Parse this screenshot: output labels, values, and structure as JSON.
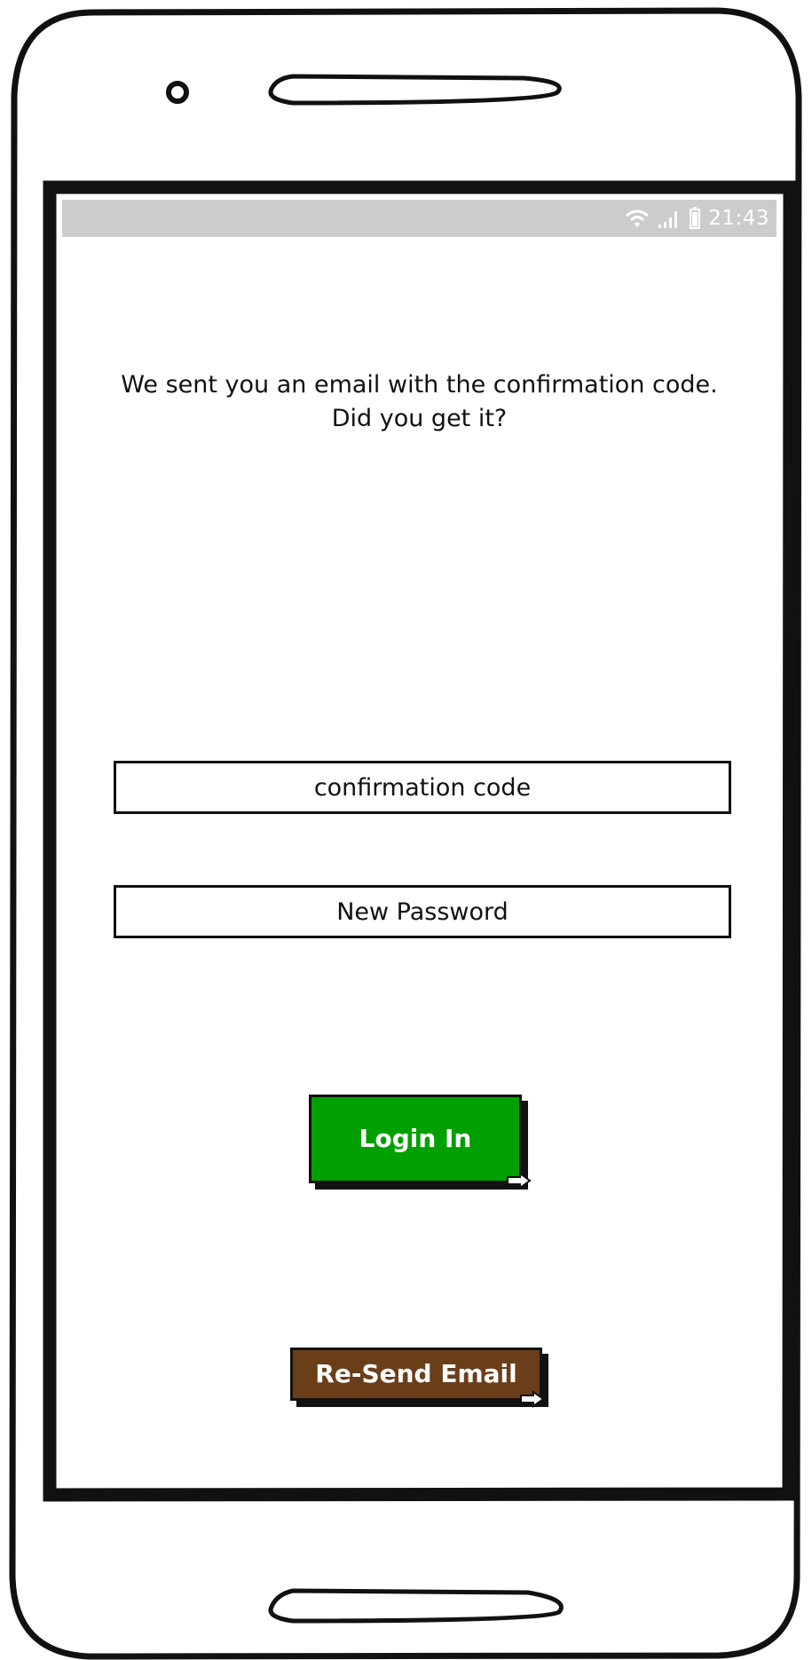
{
  "status_bar": {
    "time": "21:43",
    "icons": [
      "wifi-icon",
      "signal-icon",
      "battery-icon"
    ],
    "background_color": "#cccccc"
  },
  "message": {
    "line1": "We sent you an email with the confirmation code.",
    "line2": "Did you get it?"
  },
  "form": {
    "confirmation_code_placeholder": "confirmation code",
    "new_password_placeholder": "New Password"
  },
  "buttons": {
    "login_label": "Login In",
    "login_color": "#00a000",
    "resend_label": "Re-Send Email",
    "resend_color": "#6b3e1a",
    "link_icon": "link-arrow-icon"
  }
}
